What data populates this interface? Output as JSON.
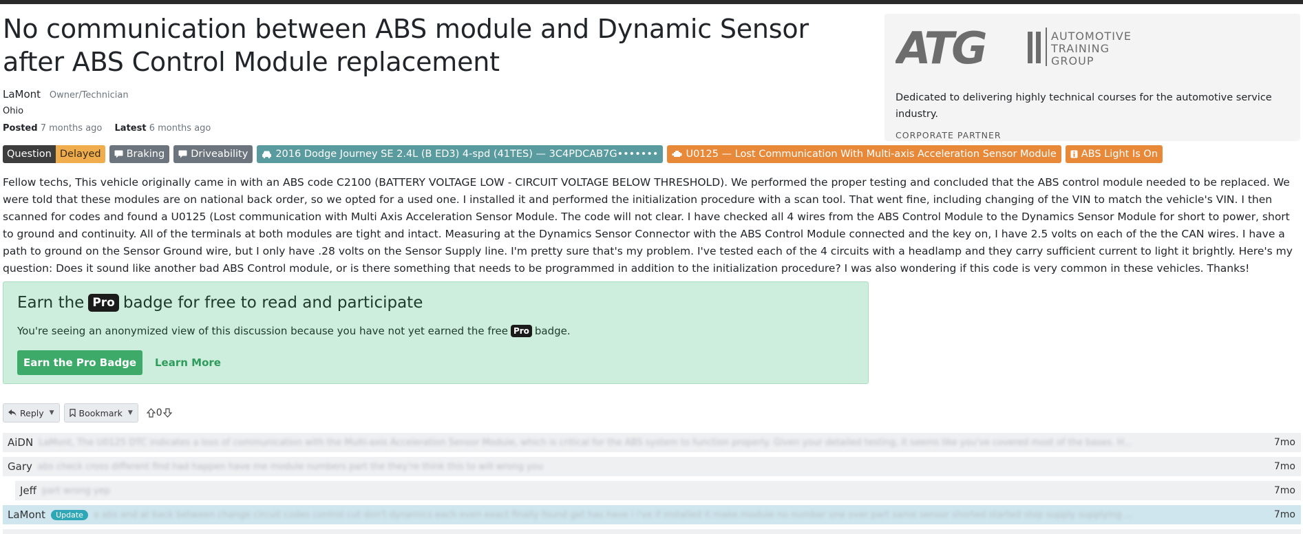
{
  "post": {
    "title": "No communication between ABS module and Dynamic Sensor after ABS Control Module replacement",
    "author": "LaMont",
    "author_role": "Owner/Technician",
    "location": "Ohio",
    "posted_label": "Posted",
    "posted_value": "7 months ago",
    "latest_label": "Latest",
    "latest_value": "6 months ago",
    "body": "Fellow techs, This vehicle originally came in with an ABS code C2100 (BATTERY VOLTAGE LOW - CIRCUIT VOLTAGE BELOW THRESHOLD). We performed the proper testing and concluded that the ABS control module needed to be replaced. We were told that these modules are on national back order, so we opted for a used one. I installed it and performed the initialization procedure with a scan tool. That went fine, including changing of the VIN to match the vehicle's VIN. I then scanned for codes and found a U0125 (Lost communication with Multi Axis Acceleration Sensor Module. The code will not clear. I have checked all 4 wires from the ABS Control Module to the Dynamics Sensor Module for short to power, short to ground and continuity. All of the terminals at both modules are tight and intact. Measuring at the Dynamics Sensor Connector with the ABS Control Module connected and the key on, I have 2.5 volts on each of the the CAN wires. I have a path to ground on the Sensor Ground wire, but I only have .28 volts on the Sensor Supply line. I'm pretty sure that's my problem. I've tested each of the 4 circuits with a headlamp and they carry sufficient current to light it brightly. Here's my question: Does it sound like another bad ABS Control module, or is there something that needs to be programmed in addition to the initialization procedure? I was also wondering if this code is very common in these vehicles. Thanks!"
  },
  "tags": {
    "question": "Question",
    "status": "Delayed",
    "braking": "Braking",
    "driveability": "Driveability",
    "vehicle": "2016 Dodge Journey SE 2.4L (B ED3) 4-spd (41TES) — 3C4PDCAB7G•••••••",
    "code": "U0125 — Lost Communication With Multi-axis Acceleration Sensor Module",
    "symptom": "ABS Light Is On"
  },
  "partner": {
    "logo_mark": "ATG",
    "logo_line1": "AUTOMOTIVE",
    "logo_line2": "TRAINING",
    "logo_line3": "GROUP",
    "description": "Dedicated to delivering highly technical courses for the automotive service industry.",
    "label": "CORPORATE PARTNER"
  },
  "pro_box": {
    "head_before": "Earn the",
    "pro": "Pro",
    "head_after": "badge for free to read and participate",
    "sub_before": "You're seeing an anonymized view of this discussion because you have not yet earned the free",
    "sub_after": "badge.",
    "button": "Earn the Pro Badge",
    "link": "Learn More"
  },
  "actions": {
    "reply": "Reply",
    "bookmark": "Bookmark",
    "votes": "0"
  },
  "replies": [
    {
      "name": "AiDN",
      "snippet": "LaMont, The U0125 DTC indicates a loss of communication with the Multi-axis Acceleration Sensor Module, which is critical for the ABS system to function properly. Given your detailed testing, it seems like you've covered most of the bases. H...",
      "age": "7mo"
    },
    {
      "name": "Gary",
      "snippet": "abs check cross different find had happen have me module numbers part the they're think this to will wrong you",
      "age": "7mo"
    },
    {
      "name": "Jeff",
      "snippet": "part wrong yep",
      "age": "7mo"
    },
    {
      "name": "LaMont",
      "badge": "Update",
      "snippet": "a abs and at back between change circuit codes control cut don't dynamics each even exact finally found get has have i i've if installed it make module no number one over part same sensor shorted started stop supply supplying ...",
      "age": "7mo"
    }
  ]
}
